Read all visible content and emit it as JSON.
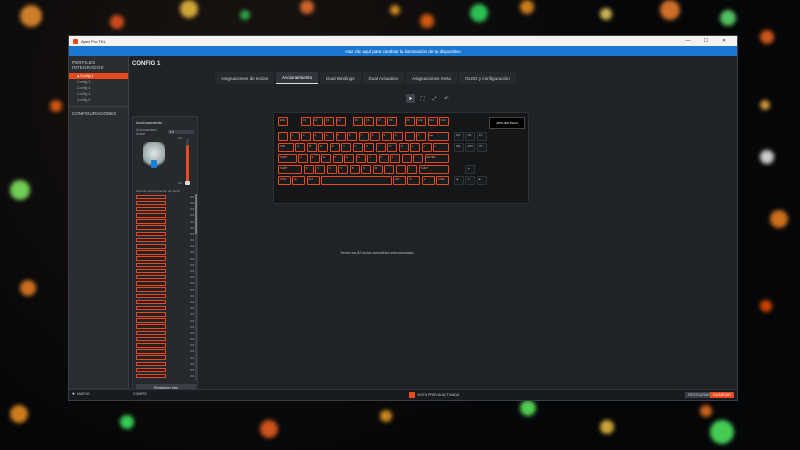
{
  "window": {
    "title": "Apex Pro TKL"
  },
  "banner": {
    "text": "Haz clic aquí para cambiar la iluminación de tu dispositivo"
  },
  "sidebar": {
    "section1": "PERFILES INTEGRADOS",
    "items": [
      "Config 1",
      "Config 2",
      "Config 3",
      "Config 4",
      "Config 5"
    ],
    "section2": "CONFIGURACIONES"
  },
  "main": {
    "title": "CONFIG 1"
  },
  "tabs": [
    "Asignaciones de teclas",
    "Accionamiento",
    "Dual Bindings",
    "Dual Actuation",
    "Asignaciones meta",
    "OLED y configuración"
  ],
  "actuation": {
    "title": "Accionamiento",
    "current_label": "Accionamiento Actual",
    "current_value": "3.6",
    "slider_top": "0.2",
    "slider_bottom": "3.6",
    "slider_level": 0.85,
    "list_label": "Nivel de accionamiento por tecla",
    "reset_label": "Restablecer todo"
  },
  "keyboard": {
    "oled_text": "APPLIED TECH",
    "status": "Tienes las 82 teclas accesibles seleccionadas."
  },
  "bottom": {
    "new_label": "NUEVO",
    "config_label": "CONFIG",
    "preview_label": "VISTA PREVIA ACTIVADA",
    "restore_label": "RESTAURAR",
    "save_label": "GUARDAR"
  },
  "colors": {
    "accent": "#e8491d",
    "banner": "#1b78d2"
  }
}
